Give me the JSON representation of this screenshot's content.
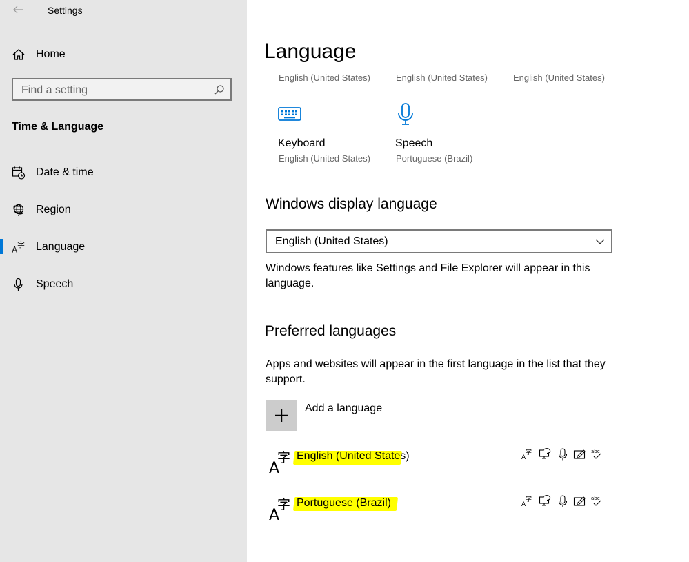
{
  "window": {
    "title": "Settings"
  },
  "sidebar": {
    "home_label": "Home",
    "search_placeholder": "Find a setting",
    "section_title": "Time & Language",
    "items": [
      {
        "label": "Date & time",
        "icon": "calendar-clock-icon"
      },
      {
        "label": "Region",
        "icon": "globe-icon"
      },
      {
        "label": "Language",
        "icon": "language-icon",
        "selected": true
      },
      {
        "label": "Speech",
        "icon": "microphone-icon"
      }
    ]
  },
  "main": {
    "title": "Language",
    "top_row": [
      "English (United States)",
      "English (United States)",
      "English (United States)"
    ],
    "tiles": [
      {
        "label": "Keyboard",
        "sub": "English (United States)",
        "icon": "keyboard-icon"
      },
      {
        "label": "Speech",
        "sub": "Portuguese (Brazil)",
        "icon": "microphone-icon"
      }
    ],
    "display_language": {
      "heading": "Windows display language",
      "selected": "English (United States)",
      "description": "Windows features like Settings and File Explorer will appear in this language."
    },
    "preferred": {
      "heading": "Preferred languages",
      "description": "Apps and websites will appear in the first language in the list that they support.",
      "add_label": "Add a language",
      "languages": [
        {
          "name": "English (United States)",
          "features": [
            "display-language-icon",
            "text-to-speech-icon",
            "speech-recognition-icon",
            "handwriting-icon",
            "spellcheck-icon"
          ]
        },
        {
          "name": "Portuguese (Brazil)",
          "features": [
            "display-language-icon",
            "text-to-speech-icon",
            "speech-recognition-icon",
            "handwriting-icon",
            "spellcheck-icon"
          ]
        }
      ]
    }
  },
  "colors": {
    "accent": "#0078d7",
    "sidebar_bg": "#e6e6e6",
    "highlight": "#ffff00"
  }
}
